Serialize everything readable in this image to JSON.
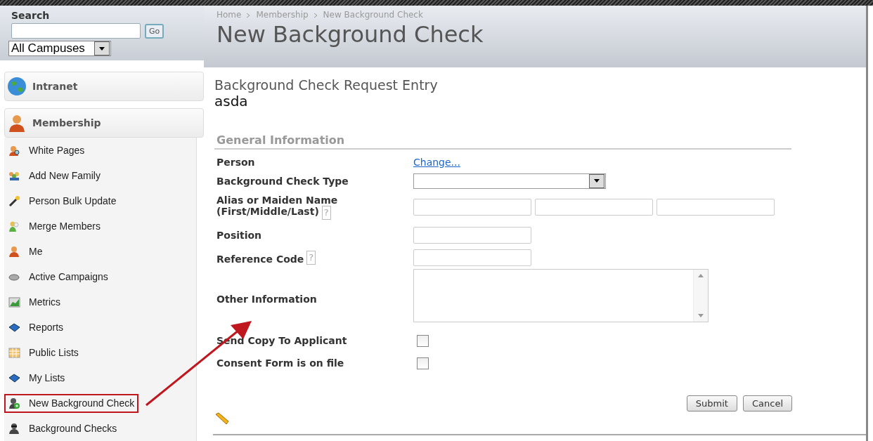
{
  "search": {
    "label": "Search",
    "button": "Go",
    "campus": "All Campuses"
  },
  "sidebar": {
    "sections": [
      {
        "label": "Intranet",
        "kind": "globe"
      },
      {
        "label": "Membership",
        "kind": "person",
        "items": [
          {
            "label": "White Pages",
            "kind": "finder",
            "highlighted": false
          },
          {
            "label": "Add New Family",
            "kind": "family",
            "highlighted": false
          },
          {
            "label": "Person Bulk Update",
            "kind": "wand",
            "highlighted": false
          },
          {
            "label": "Merge Members",
            "kind": "merge",
            "highlighted": false
          },
          {
            "label": "Me",
            "kind": "person",
            "highlighted": false
          },
          {
            "label": "Active Campaigns",
            "kind": "phone",
            "highlighted": false
          },
          {
            "label": "Metrics",
            "kind": "chart",
            "highlighted": false
          },
          {
            "label": "Reports",
            "kind": "book",
            "highlighted": false
          },
          {
            "label": "Public Lists",
            "kind": "grid",
            "highlighted": false
          },
          {
            "label": "My Lists",
            "kind": "book",
            "highlighted": false
          },
          {
            "label": "New Background Check",
            "kind": "agentadd",
            "highlighted": true
          },
          {
            "label": "Background Checks",
            "kind": "agent",
            "highlighted": false
          }
        ]
      }
    ]
  },
  "breadcrumb": [
    "Home",
    "Membership",
    "New Background Check"
  ],
  "page_title": "New Background Check",
  "form": {
    "title": "Background Check Request Entry",
    "subtitle": "asda",
    "section": "General Information",
    "rows": [
      {
        "kind": "link",
        "label": "Person",
        "link": "Change..."
      },
      {
        "kind": "select",
        "label": "Background Check Type"
      },
      {
        "kind": "triple",
        "label": "Alias or Maiden Name",
        "label_2": "(First/Middle/Last)",
        "help": "?"
      },
      {
        "kind": "text",
        "label": "Position"
      },
      {
        "kind": "text",
        "label": "Reference Code",
        "help": "?"
      },
      {
        "kind": "textarea",
        "label": "Other Information"
      },
      {
        "kind": "checkbox",
        "label": "Send Copy To Applicant",
        "checked": false
      },
      {
        "kind": "checkbox",
        "label": "Consent Form is on file",
        "checked": false
      }
    ],
    "buttons": [
      "Submit",
      "Cancel"
    ]
  }
}
